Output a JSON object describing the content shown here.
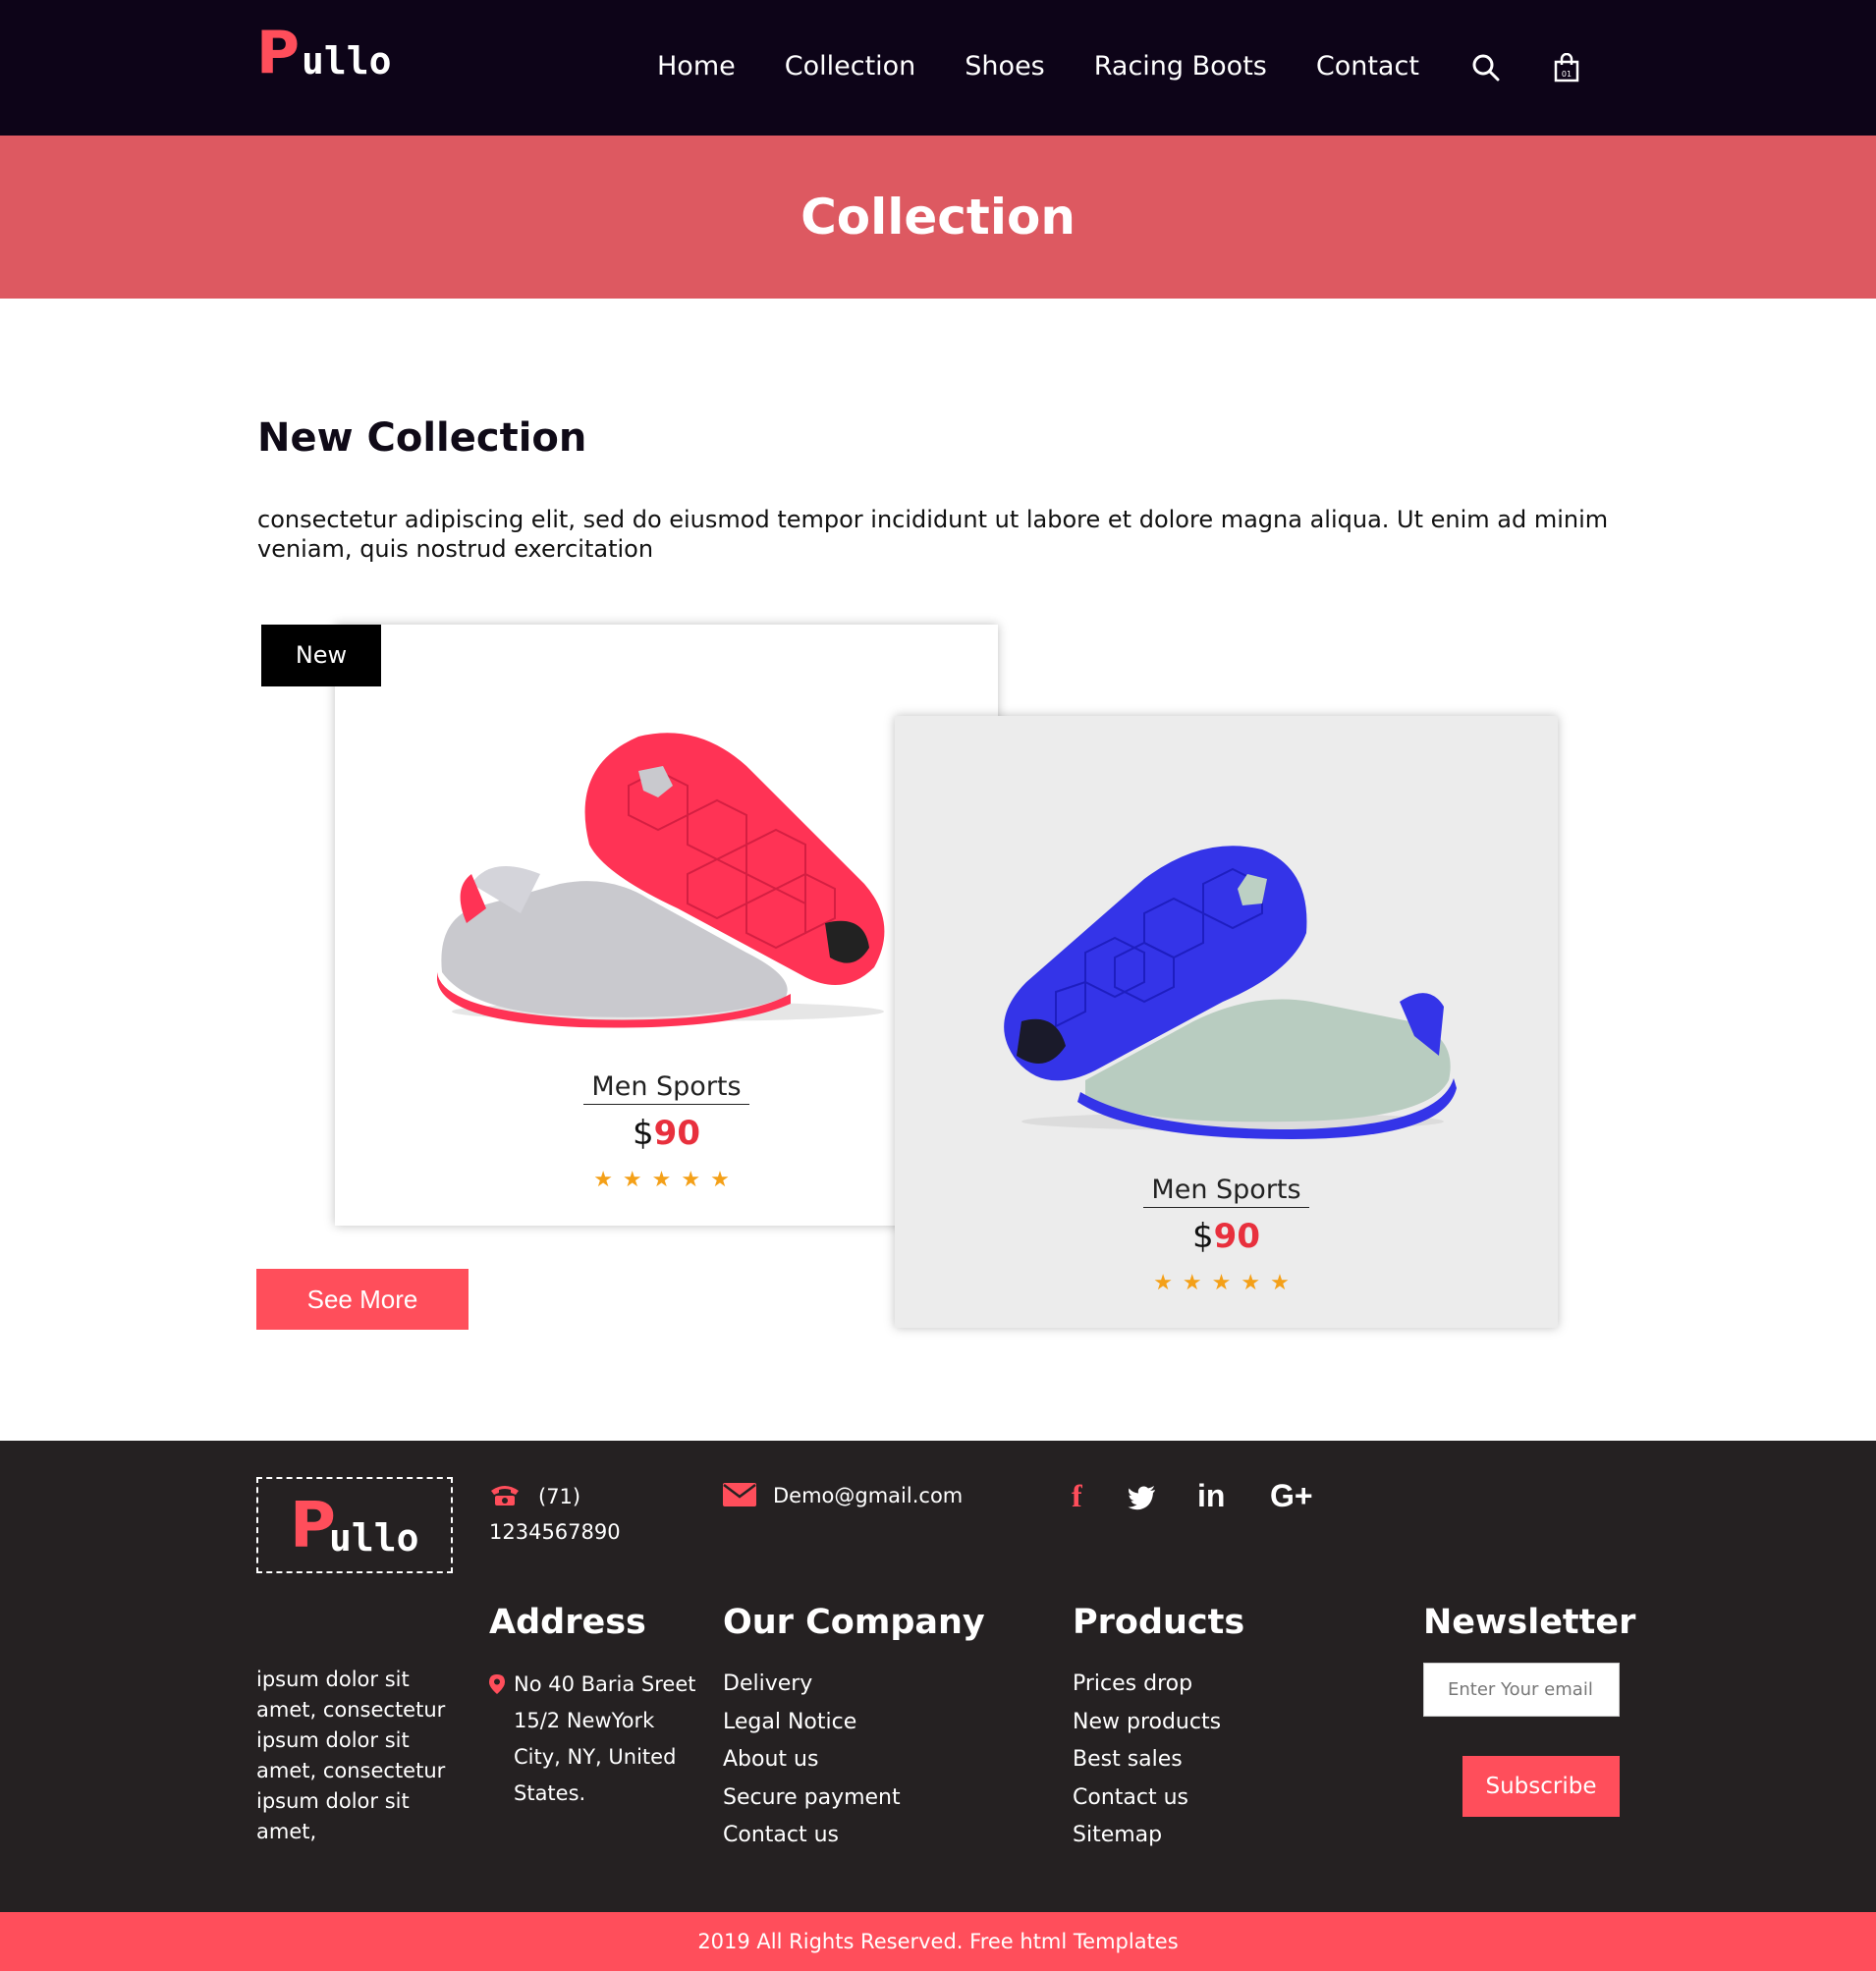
{
  "brand": {
    "logo_letter": "P",
    "logo_rest": "ullo"
  },
  "nav": {
    "items": [
      "Home",
      "Collection",
      "Shoes",
      "Racing Boots",
      "Contact"
    ],
    "search_icon": "search-icon",
    "cart_icon": "shopping-bag-icon",
    "cart_count": "01"
  },
  "hero": {
    "title": "Collection"
  },
  "main": {
    "title": "New Collection",
    "description": "consectetur adipiscing elit, sed do eiusmod tempor incididunt ut labore et dolore magna aliqua. Ut enim ad minim veniam, quis nostrud exercitation",
    "see_more": "See More",
    "products": [
      {
        "badge": "New",
        "name": "Men Sports",
        "currency": "$",
        "price": "90",
        "rating": 5,
        "stars": "★★★★★",
        "accent": "#ff3355"
      },
      {
        "name": "Men Sports",
        "currency": "$",
        "price": "90",
        "rating": 5,
        "stars": "★★★★★",
        "accent": "#3434e8"
      }
    ]
  },
  "footer": {
    "logo_letter": "P",
    "logo_rest": "ullo",
    "phone": "(71) 1234567890",
    "email": "Demo@gmail.com",
    "social": {
      "facebook": "f",
      "linkedin": "in",
      "googleplus": "G+"
    },
    "about": "ipsum dolor sit amet, consectetur ipsum dolor sit amet, consectetur ipsum dolor sit amet,",
    "address": {
      "title": "Address",
      "text": "No 40 Baria Sreet 15/2 NewYork City, NY, United States."
    },
    "company": {
      "title": "Our Company",
      "items": [
        "Delivery",
        "Legal Notice",
        "About us",
        "Secure payment",
        "Contact us"
      ]
    },
    "products": {
      "title": "Products",
      "items": [
        "Prices drop",
        "New products",
        "Best sales",
        "Contact us",
        "Sitemap"
      ]
    },
    "newsletter": {
      "title": "Newsletter",
      "placeholder": "Enter Your email",
      "button": "Subscribe"
    },
    "copyright": "2019 All Rights Reserved. Free html Templates"
  },
  "colors": {
    "accent": "#ff4e5b",
    "header_bg": "#0d0418",
    "hero_bg": "#dd5961",
    "footer_bg": "#252122",
    "star": "#f4a018"
  }
}
